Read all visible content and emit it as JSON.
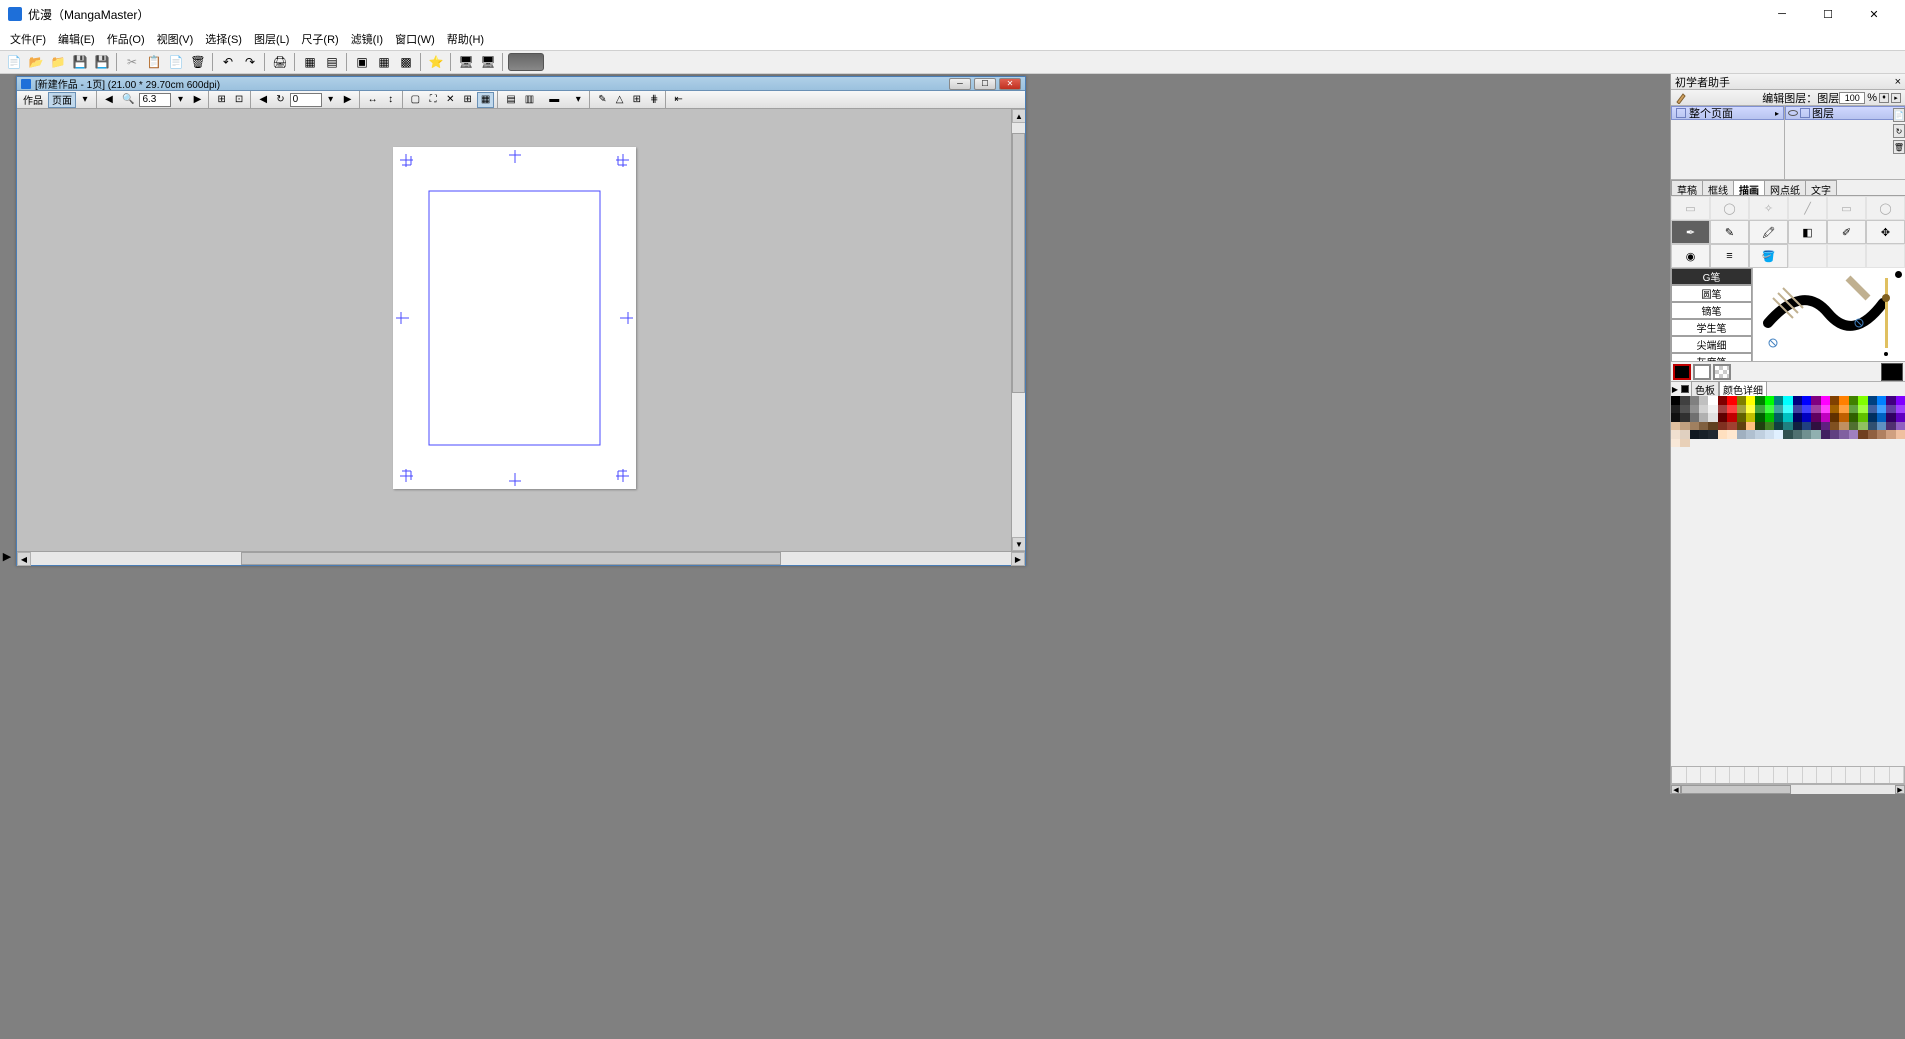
{
  "titlebar": {
    "title": "优漫（MangaMaster）"
  },
  "menus": [
    "文件(F)",
    "编辑(E)",
    "作品(O)",
    "视图(V)",
    "选择(S)",
    "图层(L)",
    "尺子(R)",
    "滤镜(I)",
    "窗口(W)",
    "帮助(H)"
  ],
  "doc": {
    "title": "[新建作品 - 1页] (21.00 * 29.70cm 600dpi)",
    "tabs": {
      "work": "作品",
      "page": "页面"
    },
    "zoom": "6.3",
    "angle": "0"
  },
  "helper_title": "初学者助手",
  "editor": {
    "label": "编辑图层：",
    "layer_name": "图层",
    "opacity": "100",
    "pct": "%"
  },
  "layers": {
    "whole_page": "整个页面",
    "layer": "图层"
  },
  "tool_tabs": [
    "草稿",
    "框线",
    "描画",
    "网点纸",
    "文字"
  ],
  "tool_tabs_active": 2,
  "pens": [
    "G笔",
    "圆笔",
    "镝笔",
    "学生笔",
    "尖端细",
    "灰度笔"
  ],
  "pens_active": 0,
  "swatch_tabs": [
    "色板",
    "颜色详细"
  ],
  "swatch_colors": [
    "#000000",
    "#404040",
    "#808080",
    "#c0c0c0",
    "#ffffff",
    "#800000",
    "#ff0000",
    "#808000",
    "#ffff00",
    "#008000",
    "#00ff00",
    "#008080",
    "#00ffff",
    "#000080",
    "#0000ff",
    "#800080",
    "#ff00ff",
    "#804000",
    "#ff8000",
    "#408000",
    "#80ff00",
    "#004080",
    "#0080ff",
    "#400080",
    "#8000ff",
    "#202020",
    "#505050",
    "#909090",
    "#d0d0d0",
    "#f0f0f0",
    "#a04040",
    "#ff4040",
    "#a0a040",
    "#ffff40",
    "#40a040",
    "#40ff40",
    "#40a0a0",
    "#40ffff",
    "#4040a0",
    "#4040ff",
    "#a040a0",
    "#ff40ff",
    "#a06000",
    "#ffa040",
    "#60a040",
    "#a0ff40",
    "#4060a0",
    "#40a0ff",
    "#6040a0",
    "#a040ff",
    "#101010",
    "#303030",
    "#707070",
    "#b0b0b0",
    "#e0e0e0",
    "#600000",
    "#c00000",
    "#606000",
    "#c0c000",
    "#006000",
    "#00c000",
    "#006060",
    "#00c0c0",
    "#000060",
    "#0000c0",
    "#600060",
    "#c000c0",
    "#603000",
    "#c06000",
    "#306000",
    "#60c000",
    "#003060",
    "#0060c0",
    "#300060",
    "#6000c0",
    "#e0c0a0",
    "#c0a080",
    "#a08060",
    "#806040",
    "#604020",
    "#803020",
    "#a04030",
    "#604010",
    "#ffc080",
    "#204010",
    "#408020",
    "#104040",
    "#208080",
    "#102040",
    "#204080",
    "#301040",
    "#602080",
    "#805020",
    "#c09060",
    "#507030",
    "#90c060",
    "#305070",
    "#6090c0",
    "#503070",
    "#9060c0",
    "#f0e0d0",
    "#e0d0c0",
    "#101820",
    "#182028",
    "#202830",
    "#ffe0c0",
    "#ffe8d0",
    "#a0b0c0",
    "#b0c0d0",
    "#c0d0e0",
    "#d0e0f0",
    "#e0f0ff",
    "#305050",
    "#507070",
    "#709090",
    "#90b0b0",
    "#402060",
    "#604080",
    "#8060a0",
    "#a080c0",
    "#704020",
    "#906040",
    "#b08060",
    "#d0a080",
    "#f0c0a0",
    "#f8e8d8",
    "#e8d0b8"
  ]
}
